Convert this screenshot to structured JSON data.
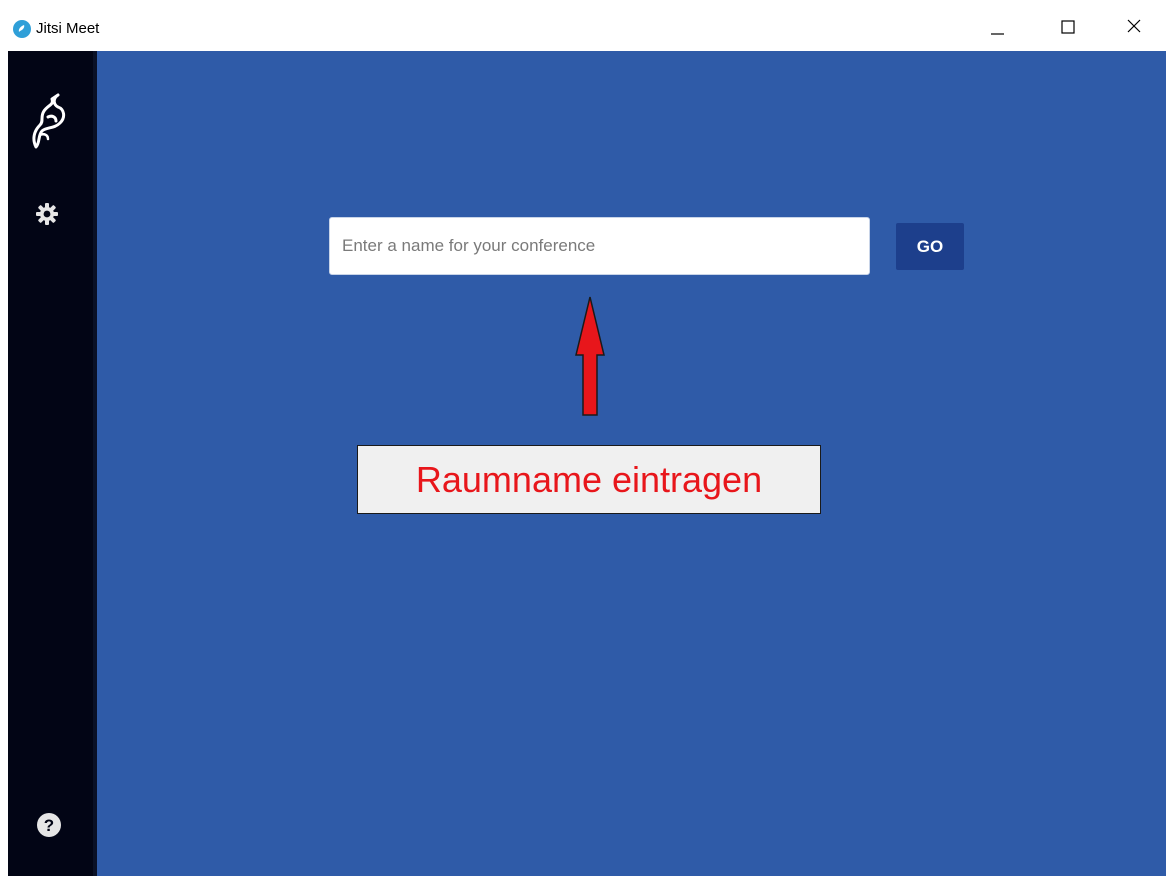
{
  "window": {
    "title": "Jitsi Meet",
    "app_icon": "jitsi-logo-icon",
    "controls": {
      "minimize_icon": "minimize-icon",
      "maximize_icon": "maximize-icon",
      "close_icon": "close-icon"
    }
  },
  "sidebar": {
    "logo_icon": "jitsi-logo-icon",
    "settings_icon": "gear-icon",
    "help_icon": "help-icon"
  },
  "main": {
    "room_input": {
      "value": "",
      "placeholder": "Enter a name for your conference"
    },
    "go_label": "GO",
    "annotation": {
      "text": "Raumname eintragen",
      "arrow_icon": "arrow-up-icon"
    }
  },
  "colors": {
    "main_background": "#2f5ba8",
    "sidebar_background": "#020515",
    "go_button": "#1d3f8c",
    "annotation_text": "#e8161b",
    "annotation_box": "#f0f0f0",
    "arrow": "#e8161b"
  }
}
